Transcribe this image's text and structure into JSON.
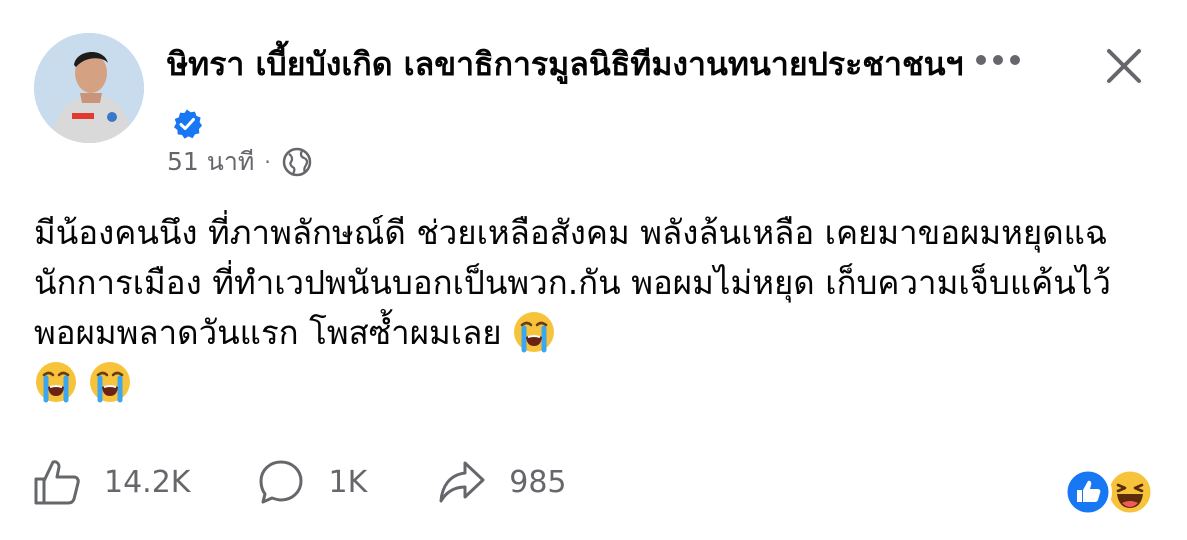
{
  "post": {
    "author_name": "ษิทรา เบี้ยบังเกิด เลขาธิการมูลนิธิทีมงานทนายประชาชนฯ",
    "verified": true,
    "time": "51 นาที",
    "separator": "·",
    "audience_icon": "globe-icon",
    "text": "มีน้องคนนึง ที่ภาพลักษณ์ดี ช่วยเหลือสังคม พลังล้นเหลือ เคยมาขอผมหยุดแฉ นักการเมือง ที่ทำเวปพนันบอกเป็นพวก.กัน พอผมไม่หยุด เก็บความเจ็บแค้นไว้ พอผมพลาดวันแรก โพสซ้ำผมเลย",
    "trailing_emojis": [
      "loudly-crying-face",
      "loudly-crying-face",
      "loudly-crying-face"
    ]
  },
  "header_icons": {
    "more": "more-horizontal-icon",
    "close": "close-icon"
  },
  "actions": {
    "likes": "14.2K",
    "comments": "1K",
    "shares": "985"
  },
  "reactions": [
    "like",
    "haha"
  ],
  "colors": {
    "verified_blue": "#1877f2",
    "secondary_text": "#65676b",
    "primary_text": "#050505",
    "haha_yellow": "#f7c33b"
  }
}
